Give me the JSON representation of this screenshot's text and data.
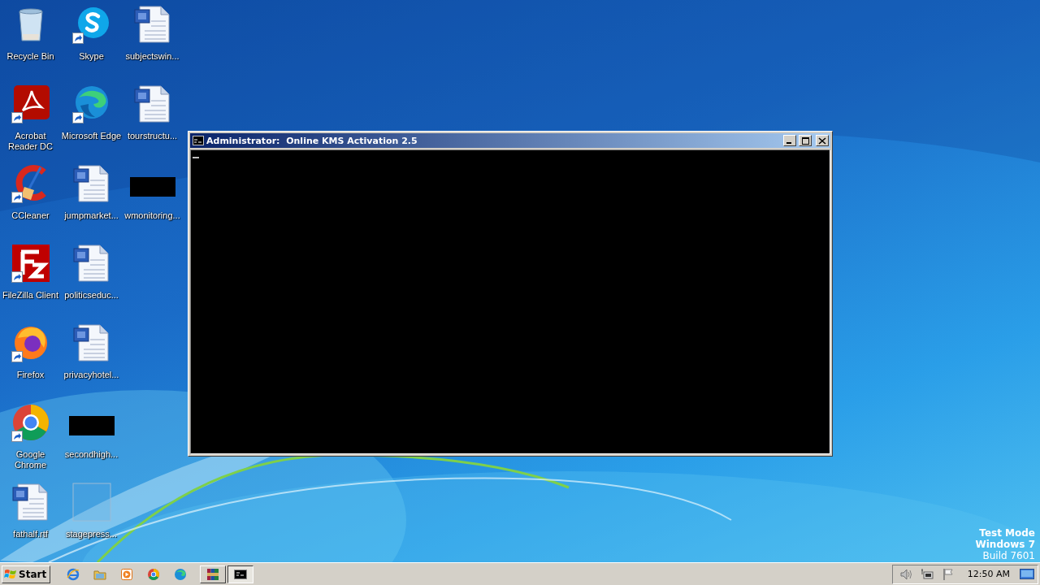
{
  "desktop": {
    "icon_columns": [
      [
        {
          "label": "Recycle Bin",
          "kind": "recycle",
          "shortcut": false
        },
        {
          "label": "Acrobat Reader DC",
          "kind": "acrobat",
          "shortcut": true
        },
        {
          "label": "CCleaner",
          "kind": "ccleaner",
          "shortcut": true
        },
        {
          "label": "FileZilla Client",
          "kind": "filezilla",
          "shortcut": true
        },
        {
          "label": "Firefox",
          "kind": "firefox",
          "shortcut": true
        },
        {
          "label": "Google Chrome",
          "kind": "chrome",
          "shortcut": true
        },
        {
          "label": "fathalf.rtf",
          "kind": "doc",
          "shortcut": false
        }
      ],
      [
        {
          "label": "Skype",
          "kind": "skype",
          "shortcut": true
        },
        {
          "label": "Microsoft Edge",
          "kind": "edge",
          "shortcut": true
        },
        {
          "label": "jumpmarket...",
          "kind": "doc",
          "shortcut": false
        },
        {
          "label": "politicseduc...",
          "kind": "doc",
          "shortcut": false
        },
        {
          "label": "privacyhotel...",
          "kind": "doc",
          "shortcut": false
        },
        {
          "label": "secondhigh...",
          "kind": "dark",
          "shortcut": false
        },
        {
          "label": "stagepress...",
          "kind": "blank",
          "shortcut": false
        }
      ],
      [
        {
          "label": "subjectswin...",
          "kind": "doc",
          "shortcut": false
        },
        {
          "label": "tourstructu...",
          "kind": "doc",
          "shortcut": false
        },
        {
          "label": "wmonitoring...",
          "kind": "dark",
          "shortcut": false
        }
      ]
    ],
    "notice": [
      {
        "text": "Test Mode",
        "bold": true
      },
      {
        "text": "Windows 7",
        "bold": true
      },
      {
        "text": "Build 7601",
        "bold": false
      }
    ]
  },
  "window": {
    "title": "Administrator:  Online KMS Activation 2.5",
    "active": true
  },
  "taskbar": {
    "start": "Start",
    "quick_launch": [
      {
        "kind": "ie"
      },
      {
        "kind": "folder"
      },
      {
        "kind": "media"
      },
      {
        "kind": "chrome"
      },
      {
        "kind": "edge"
      }
    ],
    "tasks": [
      {
        "kind": "winrar",
        "selected": false
      },
      {
        "kind": "console",
        "selected": true
      }
    ],
    "tray": [
      {
        "kind": "speaker"
      },
      {
        "kind": "network"
      },
      {
        "kind": "flag"
      }
    ],
    "clock": "12:50 AM"
  }
}
